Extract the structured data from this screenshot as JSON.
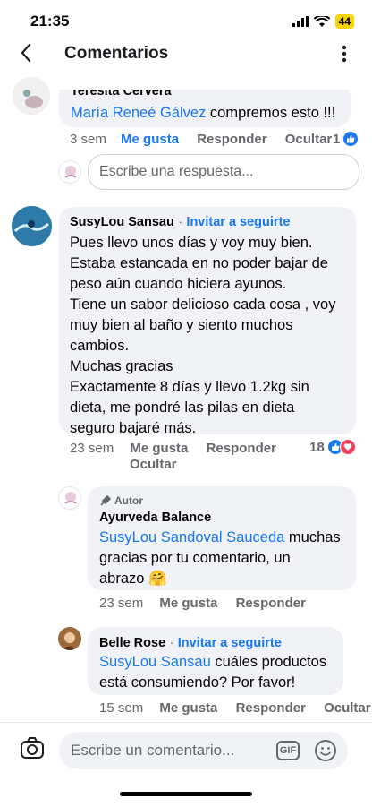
{
  "status": {
    "time": "21:35",
    "battery": "44"
  },
  "header": {
    "title": "Comentarios"
  },
  "comments": [
    {
      "name_partial": "Teresita Cervera",
      "mention": "María Reneé Gálvez",
      "text": " compremos esto !!!",
      "time": "3 sem",
      "like": "Me gusta",
      "reply": "Responder",
      "hide": "Ocultar",
      "reactions": "1"
    },
    {
      "reply_placeholder": "Escribe una respuesta..."
    },
    {
      "name": "SusyLou Sansau",
      "invite": "Invitar a seguirte",
      "separator": "·",
      "lines": [
        "Pues llevo unos días y voy muy bien.",
        "Estaba estancada en no poder bajar de",
        "peso aún cuando hiciera ayunos.",
        "Tiene un sabor delicioso cada cosa , voy",
        "muy bien al baño y siento muchos",
        "cambios.",
        "Muchas gracias",
        "Exactamente 8 días y llevo 1.2kg sin",
        "dieta, me pondré las pilas en dieta",
        "seguro bajaré más."
      ],
      "time": "23 sem",
      "like": "Me gusta",
      "reply": "Responder",
      "hide": "Ocultar",
      "reactions": "18"
    },
    {
      "author_badge": "Autor",
      "name": "Ayurveda Balance",
      "mention": "SusyLou Sandoval Sauceda",
      "line1_rest": " muchas",
      "line2": "gracias por tu comentario, un",
      "line3": "abrazo 🤗",
      "time": "23 sem",
      "like": "Me gusta",
      "reply": "Responder"
    },
    {
      "name": "Belle Rose",
      "invite": "Invitar a seguirte",
      "separator": "·",
      "mention": "SusyLou Sansau",
      "line1_rest": " cuáles productos",
      "line2": "está consumiendo? Por favor!",
      "time": "15 sem",
      "like": "Me gusta",
      "reply": "Responder",
      "hide": "Ocultar"
    }
  ],
  "composer": {
    "placeholder": "Escribe un comentario...",
    "gif": "GIF"
  }
}
